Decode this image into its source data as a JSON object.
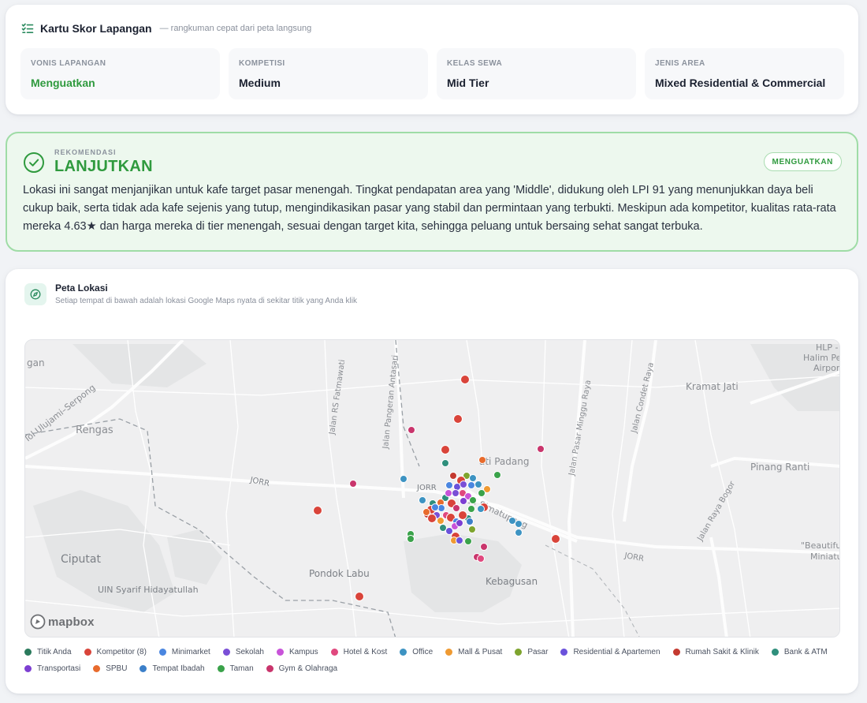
{
  "scorecard": {
    "title": "Kartu Skor Lapangan",
    "subtitle": "— rangkuman cepat dari peta langsung",
    "tiles": [
      {
        "label": "VONIS LAPANGAN",
        "value": "Menguatkan"
      },
      {
        "label": "KOMPETISI",
        "value": "Medium"
      },
      {
        "label": "KELAS SEWA",
        "value": "Mid Tier"
      },
      {
        "label": "JENIS AREA",
        "value": "Mixed Residential & Commercial"
      }
    ]
  },
  "recommendation": {
    "eyebrow": "REKOMENDASI",
    "title": "LANJUTKAN",
    "badge": "MENGUATKAN",
    "text": "Lokasi ini sangat menjanjikan untuk kafe target pasar menengah. Tingkat pendapatan area yang 'Middle', didukung oleh LPI 91 yang menunjukkan daya beli cukup baik, serta tidak ada kafe sejenis yang tutup, mengindikasikan pasar yang stabil dan permintaan yang terbukti. Meskipun ada kompetitor, kualitas rata-rata mereka 4.63★ dan harga mereka di tier menengah, sesuai dengan target kita, sehingga peluang untuk bersaing sehat sangat terbuka.",
    "accent_color": "#2f9a3e"
  },
  "map": {
    "title": "Peta Lokasi",
    "subtitle": "Setiap tempat di bawah adalah lokasi Google Maps nyata di sekitar titik yang Anda klik",
    "attribution": "mapbox",
    "labels": [
      "gan",
      "Tol Ulujami–Serpong",
      "Rengas",
      "Jalan RS Fatmawati",
      "Jalan Pangeran Antasari",
      "JORR",
      "JORR",
      "Jalan Pasar Minggu Raya",
      "Jalan Condet Raya",
      "Kramat Jati",
      "HLP -",
      "Halim Perdana",
      "Airport",
      "ati Padang",
      "Pinang Ranti",
      "Ciputat",
      "Pondok Labu",
      "UIN Syarif Hidayatullah",
      "Kebagusan",
      "Jalan Raya Bogor",
      "\"Beautiful",
      "Miniatu",
      "Jl. Simatupang",
      "JORR"
    ],
    "legend": [
      {
        "label": "Titik Anda",
        "color": "#2a7a5c"
      },
      {
        "label": "Kompetitor (8)",
        "color": "#d9443a"
      },
      {
        "label": "Minimarket",
        "color": "#4a86e0"
      },
      {
        "label": "Sekolah",
        "color": "#7a4fd6"
      },
      {
        "label": "Kampus",
        "color": "#c853d9"
      },
      {
        "label": "Hotel & Kost",
        "color": "#e0487e"
      },
      {
        "label": "Office",
        "color": "#3d93c2"
      },
      {
        "label": "Mall & Pusat",
        "color": "#ef9a32"
      },
      {
        "label": "Pasar",
        "color": "#7ea42e"
      },
      {
        "label": "Residential & Apartemen",
        "color": "#6a52db"
      },
      {
        "label": "Rumah Sakit & Klinik",
        "color": "#c43a30"
      },
      {
        "label": "Bank & ATM",
        "color": "#2f8f7c"
      },
      {
        "label": "Transportasi",
        "color": "#7d3fd2"
      },
      {
        "label": "SPBU",
        "color": "#e86b2d"
      },
      {
        "label": "Tempat Ibadah",
        "color": "#3b7fc9"
      },
      {
        "label": "Taman",
        "color": "#3aa24a"
      },
      {
        "label": "Gym & Olahraga",
        "color": "#c9356c"
      }
    ]
  }
}
